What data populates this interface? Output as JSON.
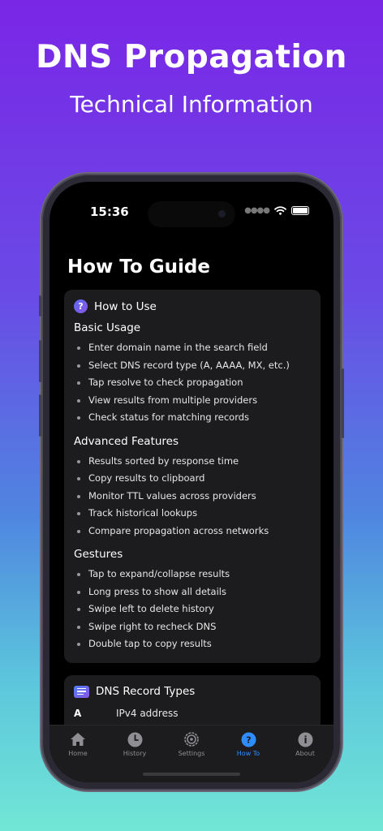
{
  "hero": {
    "title": "DNS Propagation",
    "subtitle": "Technical Information"
  },
  "status_bar": {
    "time": "15:36"
  },
  "page": {
    "title": "How To Guide"
  },
  "how_to_use": {
    "header": "How to Use",
    "icon": "question-circle-icon",
    "sections": [
      {
        "title": "Basic Usage",
        "items": [
          "Enter domain name in the search field",
          "Select DNS record type (A, AAAA, MX, etc.)",
          "Tap resolve to check propagation",
          "View results from multiple providers",
          "Check status for matching records"
        ]
      },
      {
        "title": "Advanced Features",
        "items": [
          "Results sorted by response time",
          "Copy results to clipboard",
          "Monitor TTL values across providers",
          "Track historical lookups",
          "Compare propagation across networks"
        ]
      },
      {
        "title": "Gestures",
        "items": [
          "Tap to expand/collapse results",
          "Long press to show all details",
          "Swipe left to delete history",
          "Swipe right to recheck DNS",
          "Double tap to copy results"
        ]
      }
    ]
  },
  "record_types": {
    "header": "DNS Record Types",
    "icon": "list-icon",
    "rows": [
      {
        "type": "A",
        "description": "IPv4 address"
      }
    ]
  },
  "tabbar": {
    "tabs": [
      {
        "label": "Home",
        "icon": "house-icon",
        "active": false
      },
      {
        "label": "History",
        "icon": "clock-icon",
        "active": false
      },
      {
        "label": "Settings",
        "icon": "gear-icon",
        "active": false
      },
      {
        "label": "How To",
        "icon": "question-circle-icon",
        "active": true
      },
      {
        "label": "About",
        "icon": "info-circle-icon",
        "active": false
      }
    ]
  },
  "colors": {
    "accent": "#2f8cff",
    "card_bg": "#1c1c1e",
    "screen_bg": "#000000"
  }
}
